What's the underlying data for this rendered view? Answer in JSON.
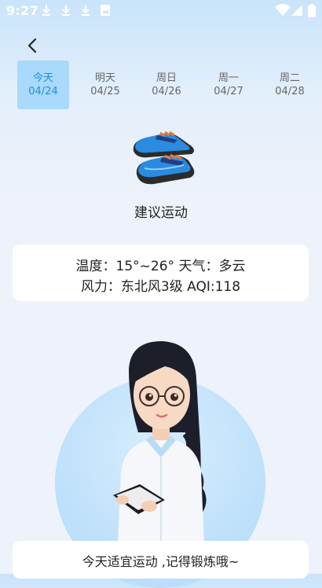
{
  "status_bar": {
    "time": "9:27",
    "icons": [
      "download-icon",
      "download-icon",
      "download-icon",
      "image-icon",
      "wifi-icon",
      "signal-icon",
      "battery-icon"
    ]
  },
  "nav": {
    "back_icon": "chevron-left-icon"
  },
  "days": [
    {
      "day": "今天",
      "date": "04/24",
      "active": true
    },
    {
      "day": "明天",
      "date": "04/25",
      "active": false
    },
    {
      "day": "周日",
      "date": "04/26",
      "active": false
    },
    {
      "day": "周一",
      "date": "04/27",
      "active": false
    },
    {
      "day": "周二",
      "date": "04/28",
      "active": false
    }
  ],
  "recommendation": {
    "icon": "sneaker-icon",
    "text": "建议运动"
  },
  "weather": {
    "line1": "温度：15°~26° 天气：多云",
    "line2": "风力：东北风3级  AQI:118"
  },
  "footer": {
    "message": "今天适宜运动 ,记得锻炼哦~"
  },
  "colors": {
    "accent": "#1e8fe0",
    "tab_active_bg": "#a9d9fb",
    "card_bg": "#ffffff",
    "page_bg": "#eef2fa"
  }
}
